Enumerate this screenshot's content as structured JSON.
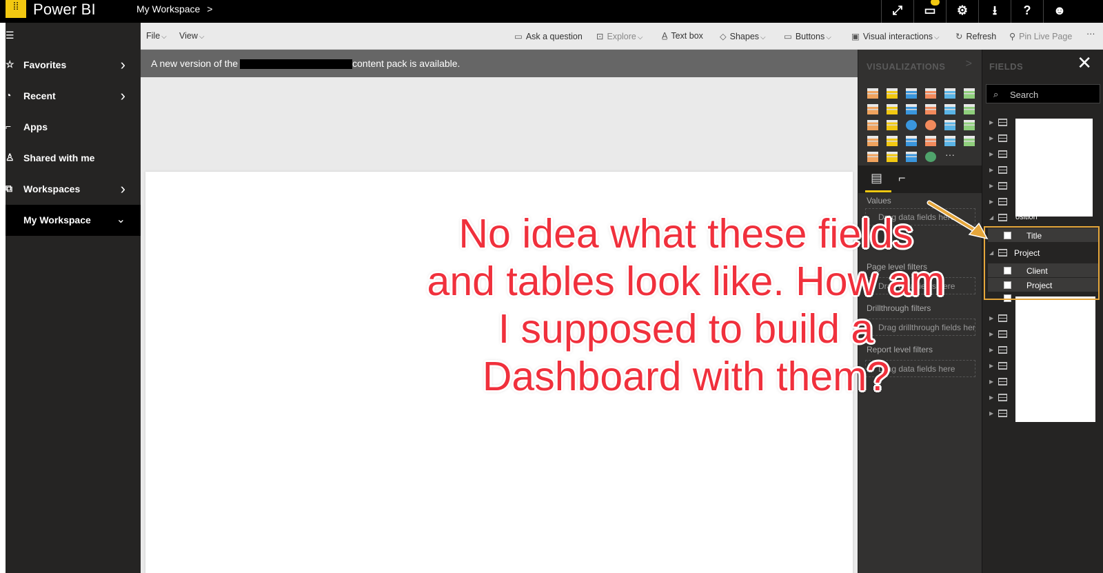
{
  "topbar": {
    "brand": "Power BI",
    "breadcrumb": "My Workspace",
    "breadcrumb_chevron": ">"
  },
  "leftnav": {
    "items": [
      {
        "label": "Favorites",
        "icon": "star-icon"
      },
      {
        "label": "Recent",
        "icon": "clock-icon"
      },
      {
        "label": "Apps",
        "icon": "apps-icon"
      },
      {
        "label": "Shared with me",
        "icon": "person-icon"
      },
      {
        "label": "Workspaces",
        "icon": "workspaces-icon"
      },
      {
        "label": "My Workspace",
        "icon": "none"
      }
    ]
  },
  "toolbar": {
    "file": "File",
    "view": "View",
    "ask": "Ask a question",
    "explore": "Explore",
    "textbox": "Text box",
    "shapes": "Shapes",
    "buttons": "Buttons",
    "visual_interactions": "Visual interactions",
    "refresh": "Refresh",
    "pin": "Pin Live Page",
    "more": "···"
  },
  "banner": {
    "pre": "A new version of the",
    "post": "content pack is available."
  },
  "viz_pane": {
    "title": "VISUALIZATIONS",
    "collapse": ">",
    "values_label": "Values",
    "values_well": "Drag data fields here",
    "page_filters_label": "Page level filters",
    "page_filters_well": "Drag data fields here",
    "drill_label": "Drillthrough filters",
    "drill_well": "Drag drillthrough fields here",
    "report_filters_label": "Report level filters",
    "report_filters_well": "Drag data fields here"
  },
  "fields_pane": {
    "title": "FIELDS",
    "search_placeholder": "Search",
    "partial_table": "osition",
    "fields": [
      {
        "label": "Title"
      },
      {
        "label": "Client"
      },
      {
        "label": "Project"
      }
    ],
    "table_project": "Project"
  },
  "annotation": {
    "line1": "No idea what these fields",
    "line2": "and tables look like. How am",
    "line3": "I supposed to build a",
    "line4": "Dashboard with them?",
    "color": "#f0303c"
  },
  "colors": {
    "accent": "#f2c811",
    "highlight": "#e5a63b",
    "banner": "#666666"
  }
}
